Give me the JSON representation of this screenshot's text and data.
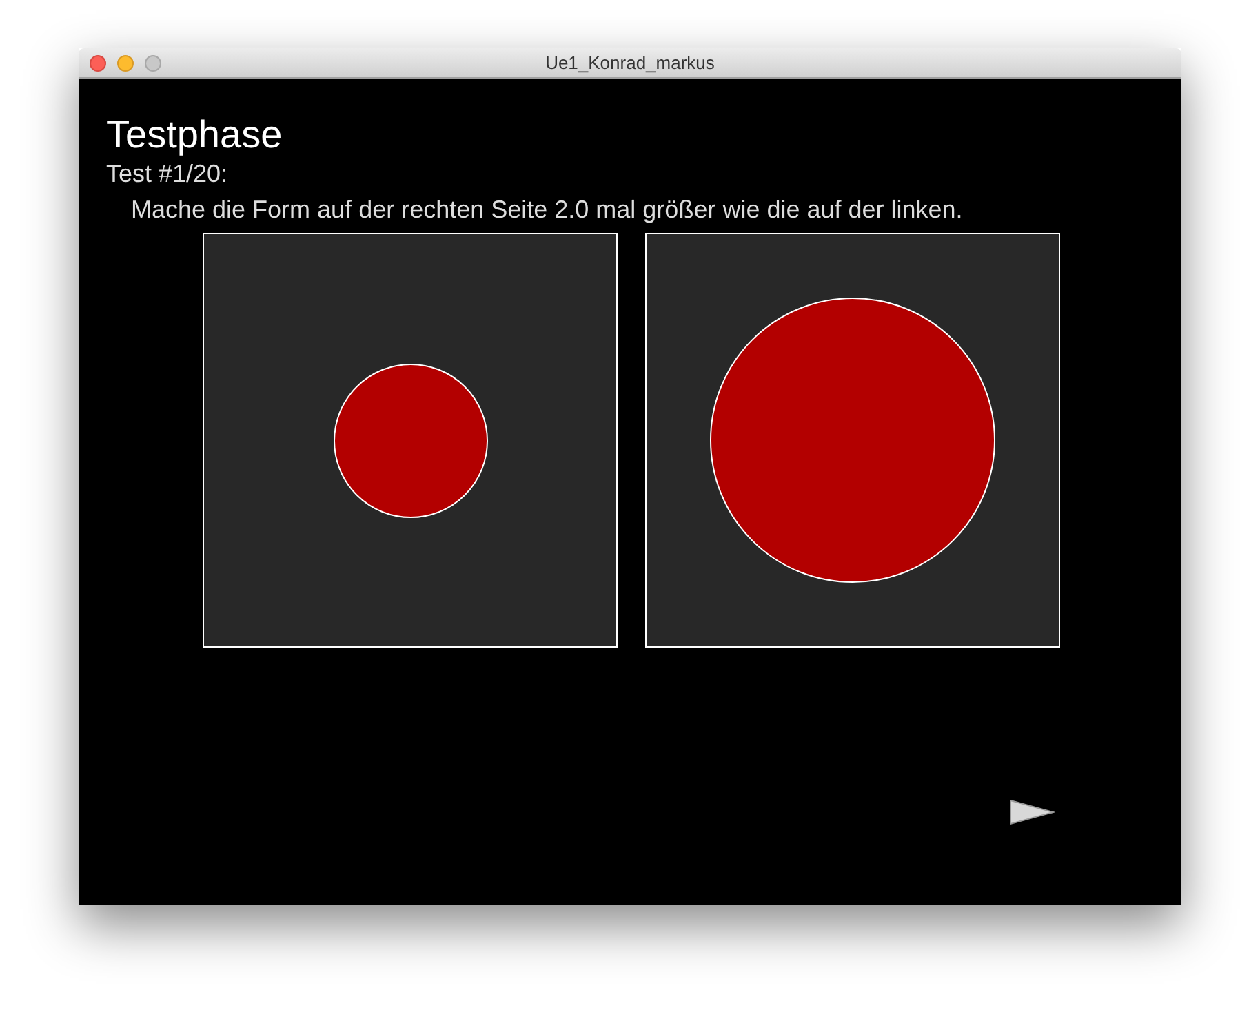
{
  "window": {
    "title": "Ue1_Konrad_markus",
    "buttons": [
      {
        "kind": "close",
        "disabled": false
      },
      {
        "kind": "minimize",
        "disabled": false
      },
      {
        "kind": "zoom",
        "disabled": true
      }
    ]
  },
  "heading": "Testphase",
  "counter": "Test #1/20:",
  "instruction": "Mache die Form auf der rechten Seite 2.0 mal größer wie die auf der linken.",
  "panels": [
    {
      "kind": "circle"
    },
    {
      "kind": "circle"
    }
  ],
  "next_button": {
    "disabled": false
  }
}
